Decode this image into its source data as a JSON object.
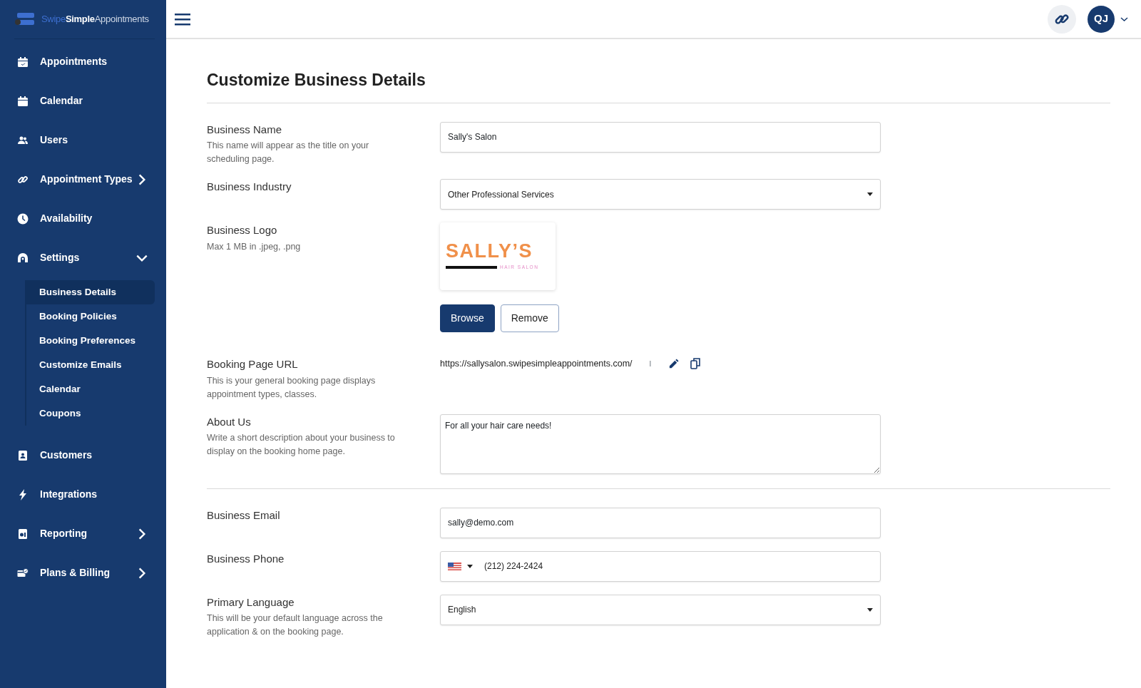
{
  "brand": {
    "part1": "Swipe",
    "part2": "Simple",
    "part3": "Appointments"
  },
  "sidebar": {
    "items": [
      {
        "label": "Appointments"
      },
      {
        "label": "Calendar"
      },
      {
        "label": "Users"
      },
      {
        "label": "Appointment Types",
        "expanded": false
      },
      {
        "label": "Availability"
      },
      {
        "label": "Settings",
        "expanded": true,
        "children": [
          {
            "label": "Business Details",
            "selected": true
          },
          {
            "label": "Booking Policies",
            "selected": false
          },
          {
            "label": "Booking Preferences",
            "selected": false
          },
          {
            "label": "Customize Emails",
            "selected": false
          },
          {
            "label": "Calendar",
            "selected": false
          },
          {
            "label": "Coupons",
            "selected": false
          }
        ]
      },
      {
        "label": "Customers"
      },
      {
        "label": "Integrations"
      },
      {
        "label": "Reporting",
        "expanded": false
      },
      {
        "label": "Plans & Billing",
        "expanded": false
      }
    ]
  },
  "header": {
    "avatar": "QJ"
  },
  "page_title": "Customize Business Details",
  "sections": [
    {
      "rows": [
        {
          "kind": "text",
          "label": "Business Name",
          "hint": "This name will appear as the title on your scheduling page.",
          "value": "Sally's Salon"
        },
        {
          "kind": "select",
          "label": "Business Industry",
          "value": "Other Professional Services"
        },
        {
          "kind": "logo",
          "label": "Business Logo",
          "hint": "Max 1 MB in .jpeg, .png",
          "logo_title": "SALLY’S",
          "logo_subtitle": "HAIR SALON",
          "buttons": [
            "Browse",
            "Remove"
          ]
        },
        {
          "kind": "url",
          "label": "Booking Page URL",
          "hint": "This is your general booking page displays appointment types, classes.",
          "value": "https://sallysalon.swipesimpleappointments.com/",
          "separator": "I"
        },
        {
          "kind": "textarea",
          "label": "About Us",
          "hint": "Write a short description about your business to display on the booking home page.",
          "value": "For all your hair care needs!"
        }
      ]
    },
    {
      "rows": [
        {
          "kind": "text",
          "label": "Business Email",
          "value": "sally@demo.com"
        },
        {
          "kind": "phone",
          "label": "Business Phone",
          "value": "(212) 224-2424"
        },
        {
          "kind": "select",
          "label": "Primary Language",
          "hint": "This will be your default language across the application & on the booking page.",
          "value": "English"
        }
      ]
    }
  ]
}
